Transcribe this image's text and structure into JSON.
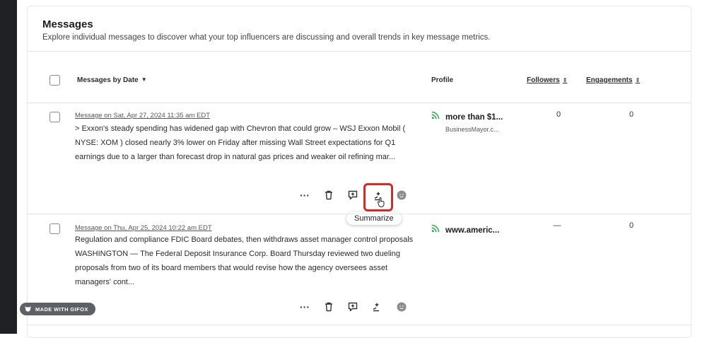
{
  "header": {
    "title": "Messages",
    "subtitle": "Explore individual messages to discover what your top influencers are discussing and overall trends in key message metrics."
  },
  "table": {
    "columns": {
      "messages": "Messages by Date",
      "messages_caret": "▼",
      "profile": "Profile",
      "followers": "Followers",
      "engagements": "Engagements",
      "sort_icon": "⇕"
    },
    "rows": [
      {
        "date": "Message on Sat, Apr 27, 2024 11:35 am EDT",
        "text": "> Exxon's steady spending has widened gap with Chevron that could grow – WSJ Exxon Mobil ( NYSE: XOM ) closed nearly 3% lower on Friday after missing Wall Street expectations for Q1 earnings due to a larger than forecast drop in natural gas prices and weaker oil refining mar...",
        "profile_name": "more than $1...",
        "profile_sub": "BusinessMayor.c...",
        "followers": "0",
        "engagements": "0"
      },
      {
        "date": "Message on Thu, Apr 25, 2024 10:22 am EDT",
        "text": "Regulation and compliance FDIC Board debates, then withdraws asset manager control proposals WASHINGTON — The Federal Deposit Insurance Corp. Board Thursday reviewed two dueling proposals from two of its board members that would revise how the agency oversees asset managers' cont...",
        "profile_name": "www.americ...",
        "profile_sub": "",
        "followers": "—",
        "engagements": "0"
      }
    ]
  },
  "actions": {
    "more": "···",
    "tooltip": "Summarize"
  },
  "badge": {
    "label": "MADE WITH GIFOX"
  },
  "icons": [
    "more-icon",
    "trash-icon",
    "comment-plus-icon",
    "summarize-icon",
    "sentiment-icon",
    "rss-icon",
    "cursor-hand-icon",
    "gifox-icon"
  ],
  "colors": {
    "highlight": "#d32a2a",
    "rss": "#2ea44f"
  }
}
